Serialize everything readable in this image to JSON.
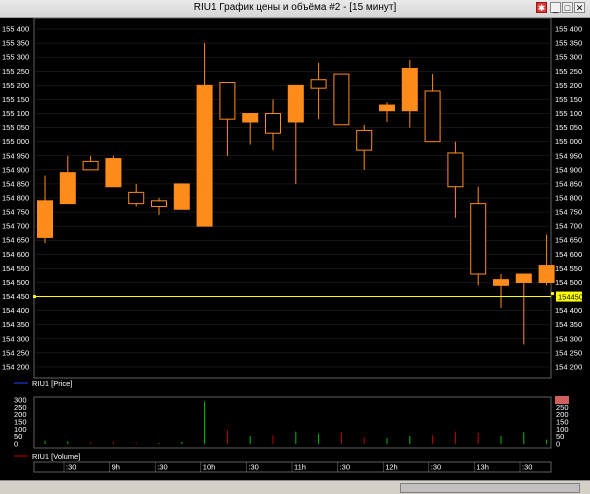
{
  "window": {
    "title": "RIU1 График цены и объёма #2 - [15 минут]",
    "buttons": {
      "minimize": "_",
      "maximize": "□",
      "close": "✕"
    },
    "pin_icon": "pin-icon"
  },
  "colors": {
    "background": "#000000",
    "candle_up": "#ff8c1a",
    "candle_down_fill": "#000000",
    "candle_down_border": "#ff8c1a",
    "level_line": "#ffff00",
    "grid": "#2a2a2a",
    "volume_up": "#00c000",
    "volume_down": "#c00000"
  },
  "price_panel": {
    "legend": "RIU1 [Price]",
    "y_ticks": [
      "155 400",
      "155 350",
      "155 300",
      "155 250",
      "155 200",
      "155 150",
      "155 100",
      "155 050",
      "155 000",
      "154 950",
      "154 900",
      "154 850",
      "154 800",
      "154 750",
      "154 700",
      "154 650",
      "154 600",
      "154 550",
      "154 500",
      "154 450",
      "154 400",
      "154 350",
      "154 300",
      "154 250",
      "154 200"
    ],
    "current_level_label": "154450"
  },
  "volume_panel": {
    "legend": "RIU1 [Volume]",
    "y_ticks": [
      "300",
      "250",
      "200",
      "150",
      "100",
      "50",
      "0"
    ],
    "current_value_label": "300"
  },
  "time_axis": {
    "labels": [
      ":30",
      "9h",
      ":30",
      "10h",
      ":30",
      "11h",
      ":30",
      "12h",
      ":30",
      "13h",
      ":30"
    ]
  },
  "chart_data": {
    "type": "candlestick",
    "ylim": [
      154175,
      155425
    ],
    "level": 154450,
    "candles": [
      {
        "o": 154660,
        "h": 154880,
        "l": 154640,
        "c": 154790
      },
      {
        "o": 154780,
        "h": 154950,
        "l": 154780,
        "c": 154890
      },
      {
        "o": 154930,
        "h": 154950,
        "l": 154910,
        "c": 154900
      },
      {
        "o": 154840,
        "h": 154950,
        "l": 154840,
        "c": 154940
      },
      {
        "o": 154820,
        "h": 154850,
        "l": 154770,
        "c": 154780
      },
      {
        "o": 154790,
        "h": 154800,
        "l": 154740,
        "c": 154770
      },
      {
        "o": 154760,
        "h": 154850,
        "l": 154760,
        "c": 154850
      },
      {
        "o": 154700,
        "h": 155350,
        "l": 154700,
        "c": 155200
      },
      {
        "o": 155210,
        "h": 155210,
        "l": 154950,
        "c": 155080
      },
      {
        "o": 155070,
        "h": 155100,
        "l": 154990,
        "c": 155100
      },
      {
        "o": 155100,
        "h": 155150,
        "l": 154970,
        "c": 155030
      },
      {
        "o": 155070,
        "h": 155200,
        "l": 154850,
        "c": 155200
      },
      {
        "o": 155220,
        "h": 155280,
        "l": 155080,
        "c": 155190
      },
      {
        "o": 155240,
        "h": 155240,
        "l": 155060,
        "c": 155060
      },
      {
        "o": 155040,
        "h": 155060,
        "l": 154900,
        "c": 154970
      },
      {
        "o": 155110,
        "h": 155140,
        "l": 155070,
        "c": 155130
      },
      {
        "o": 155110,
        "h": 155290,
        "l": 155050,
        "c": 155260
      },
      {
        "o": 155180,
        "h": 155240,
        "l": 155000,
        "c": 155000
      },
      {
        "o": 154960,
        "h": 155000,
        "l": 154730,
        "c": 154840
      },
      {
        "o": 154780,
        "h": 154840,
        "l": 154490,
        "c": 154530
      },
      {
        "o": 154490,
        "h": 154530,
        "l": 154410,
        "c": 154510
      },
      {
        "o": 154500,
        "h": 154530,
        "l": 154280,
        "c": 154530
      },
      {
        "o": 154500,
        "h": 154670,
        "l": 154490,
        "c": 154560
      }
    ],
    "volume_ylim": [
      0,
      300
    ],
    "volumes": [
      {
        "v": 22,
        "up": true
      },
      {
        "v": 18,
        "up": true
      },
      {
        "v": 12,
        "up": false
      },
      {
        "v": 15,
        "up": false
      },
      {
        "v": 8,
        "up": false
      },
      {
        "v": 6,
        "up": true
      },
      {
        "v": 14,
        "up": true
      },
      {
        "v": 290,
        "up": true
      },
      {
        "v": 95,
        "up": false
      },
      {
        "v": 55,
        "up": true
      },
      {
        "v": 60,
        "up": false
      },
      {
        "v": 85,
        "up": true
      },
      {
        "v": 70,
        "up": true
      },
      {
        "v": 80,
        "up": false
      },
      {
        "v": 45,
        "up": false
      },
      {
        "v": 40,
        "up": true
      },
      {
        "v": 55,
        "up": true
      },
      {
        "v": 60,
        "up": false
      },
      {
        "v": 85,
        "up": false
      },
      {
        "v": 75,
        "up": false
      },
      {
        "v": 55,
        "up": true
      },
      {
        "v": 80,
        "up": true
      },
      {
        "v": 30,
        "up": true
      }
    ]
  }
}
